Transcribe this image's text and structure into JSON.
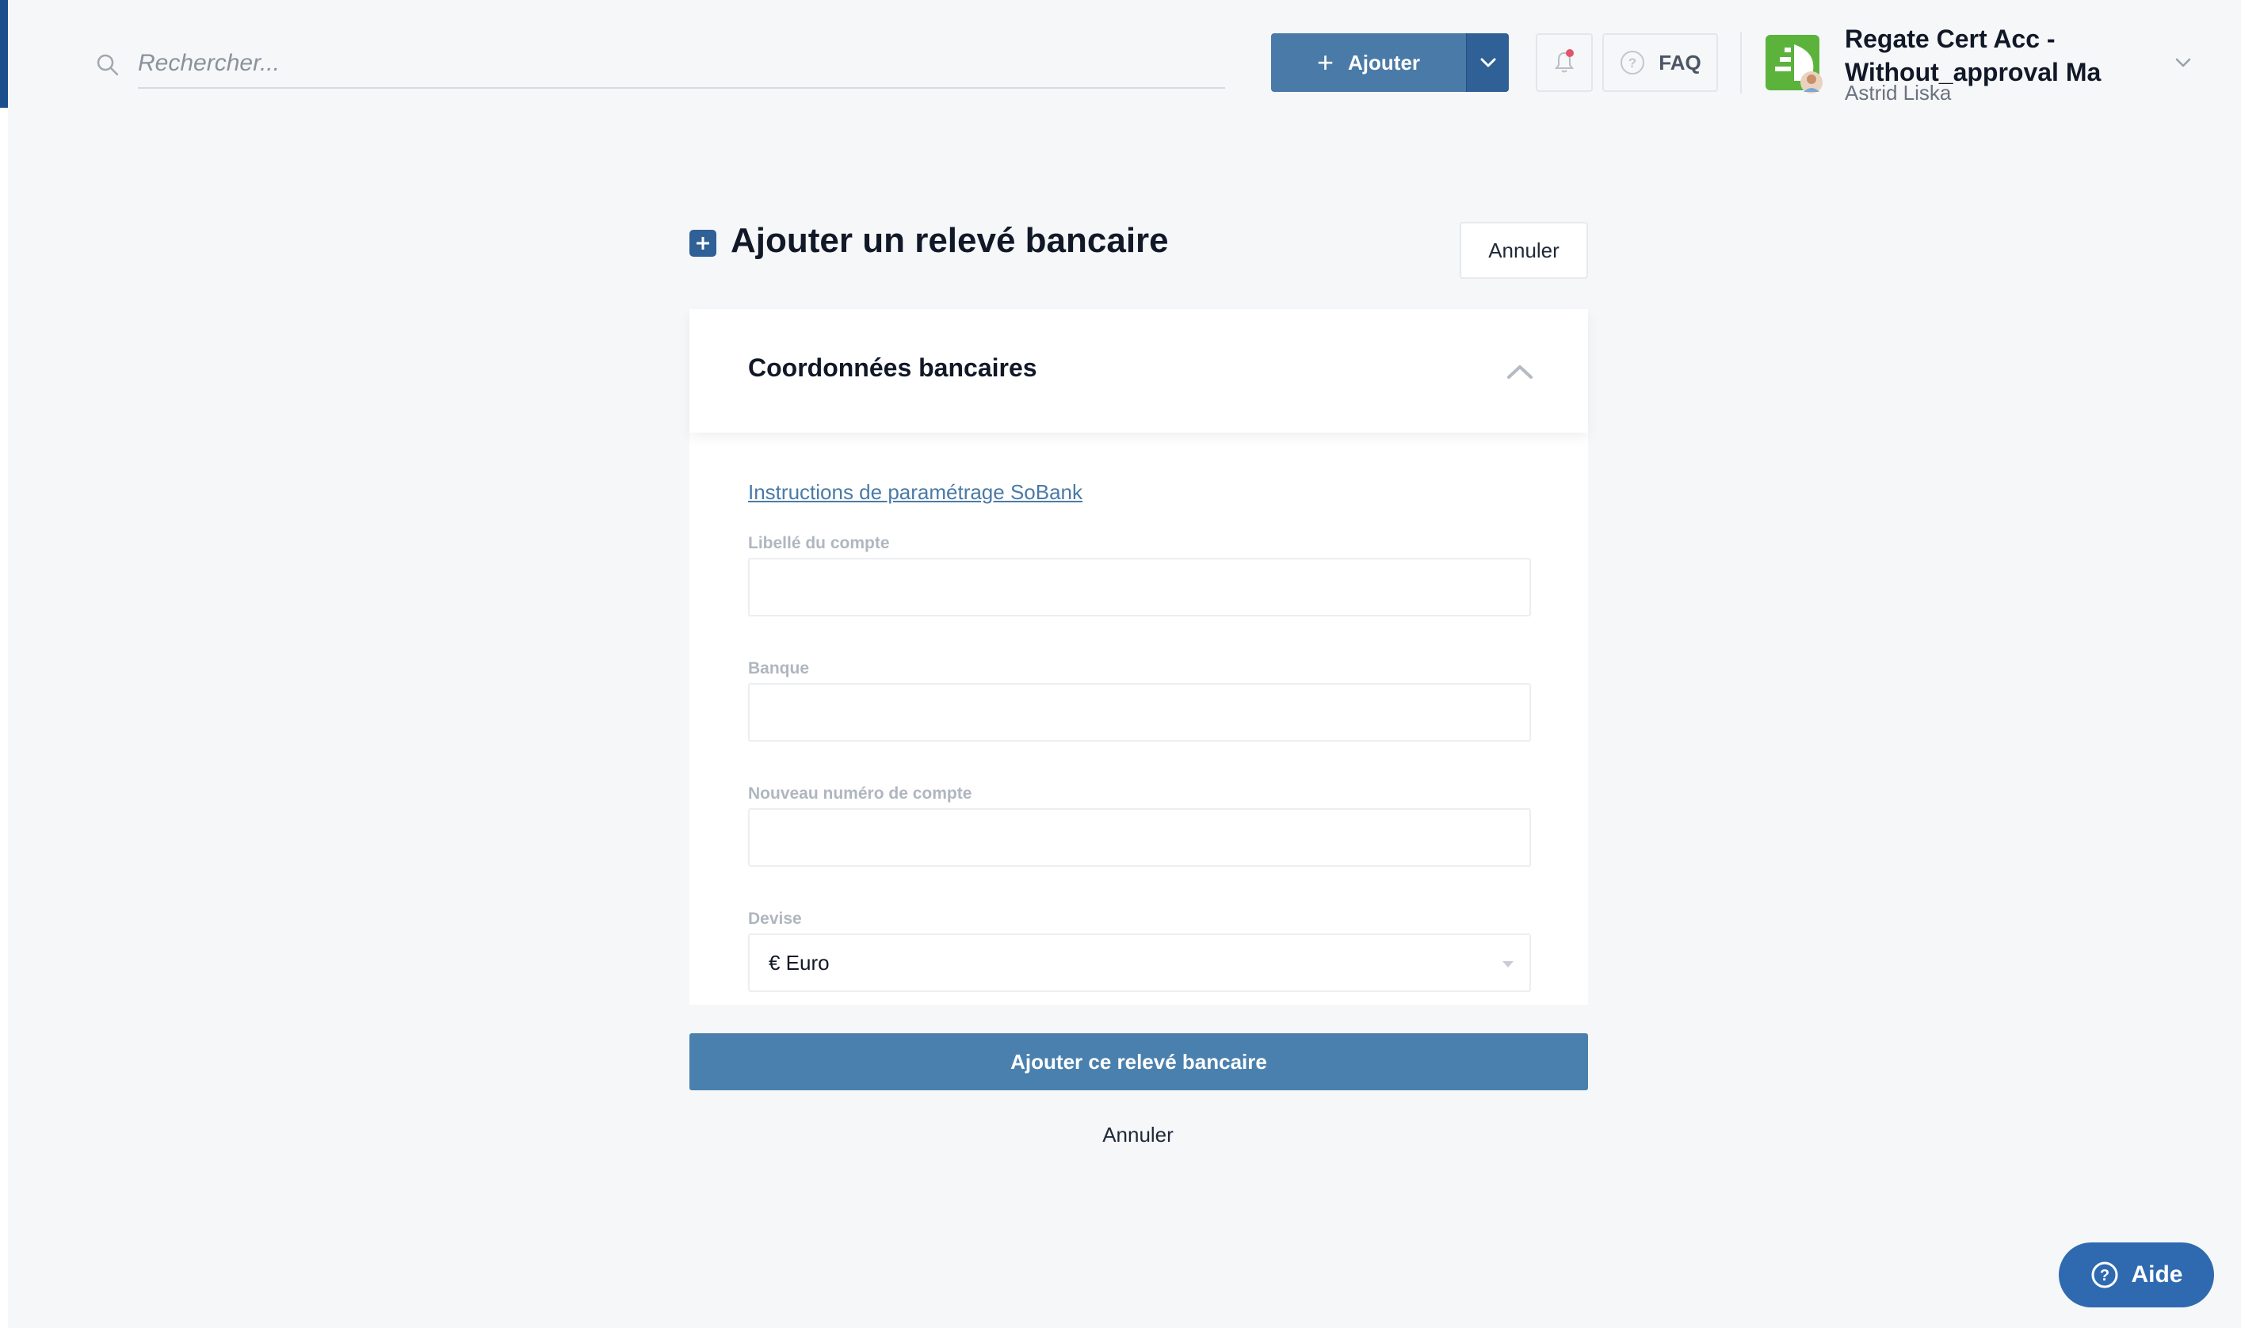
{
  "topbar": {
    "search_placeholder": "Rechercher...",
    "add_label": "Ajouter",
    "faq_label": "FAQ",
    "account_title": "Regate Cert Acc - Without_approval Ma",
    "account_user": "Astrid Liska"
  },
  "page": {
    "title": "Ajouter un relevé bancaire",
    "cancel_top": "Annuler"
  },
  "card": {
    "section_title": "Coordonnées bancaires",
    "instructions_link": "Instructions de paramétrage SoBank",
    "fields": [
      {
        "label": "Libellé du compte",
        "value": ""
      },
      {
        "label": "Banque",
        "value": ""
      },
      {
        "label": "Nouveau numéro de compte",
        "value": ""
      }
    ],
    "currency_label": "Devise",
    "currency_value": "€ Euro"
  },
  "actions": {
    "submit": "Ajouter ce relevé bancaire",
    "cancel": "Annuler"
  },
  "help": {
    "label": "Aide"
  },
  "colors": {
    "primary": "#4a7aa7",
    "primary_dark": "#2f6096",
    "background": "#f6f7f9",
    "brand_green": "#5bb33c",
    "notification_dot": "#e0556a"
  }
}
